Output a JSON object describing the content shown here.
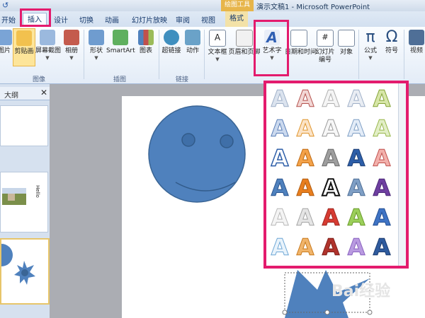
{
  "window": {
    "tools_tab_title": "绘图工具",
    "title": "演示文稿1 - Microsoft PowerPoint"
  },
  "tabs": [
    "开始",
    "插入",
    "设计",
    "切换",
    "动画",
    "幻灯片放映",
    "审阅",
    "视图",
    "格式"
  ],
  "ribbon": {
    "buttons": {
      "picture": "图片",
      "clipart": "剪贴画",
      "screenshot": "屏幕截图",
      "album": "相册",
      "shapes": "形状",
      "smartart": "SmartArt",
      "chart": "图表",
      "hyperlink": "超链接",
      "action": "动作",
      "textbox": "文本框",
      "header_footer": "页眉和页脚",
      "wordart": "艺术字",
      "datetime": "日期和时间",
      "slide_number": "幻灯片\n编号",
      "object": "对象",
      "equation": "公式",
      "symbol": "符号",
      "video": "视频"
    },
    "groups": {
      "images": "图像",
      "illustrations": "插图",
      "links": "链接"
    }
  },
  "left_pane": {
    "tab": "大纲",
    "close_icon": "close-icon",
    "thumb_text": "Hello"
  },
  "gallery": {
    "glyph": "A"
  },
  "watermark": "Bai经验",
  "colors": {
    "highlight": "#e31b6d",
    "smiley": "#4f81bd",
    "smiley_stroke": "#3a6595"
  }
}
